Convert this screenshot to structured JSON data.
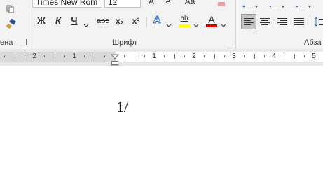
{
  "ribbon": {
    "clipboard": {
      "group_label": "ена"
    },
    "font": {
      "font_name": "Times New Rom",
      "font_size": "12",
      "grow_label": "A",
      "shrink_label": "A",
      "case_label": "Aa",
      "bold": "Ж",
      "italic": "К",
      "underline": "Ч",
      "strikethrough": "abc",
      "subscript": "x₂",
      "superscript": "x²",
      "effects_label": "A",
      "highlight_label": "ab",
      "font_color_label": "A",
      "group_label": "Шрифт",
      "highlight_color": "#ffff00",
      "font_color": "#d40000"
    },
    "paragraph": {
      "group_label": "Абза"
    }
  },
  "ruler": {
    "labels": [
      "2",
      "1",
      "1",
      "2",
      "3",
      "4",
      "5"
    ]
  },
  "document": {
    "text": "1/"
  }
}
